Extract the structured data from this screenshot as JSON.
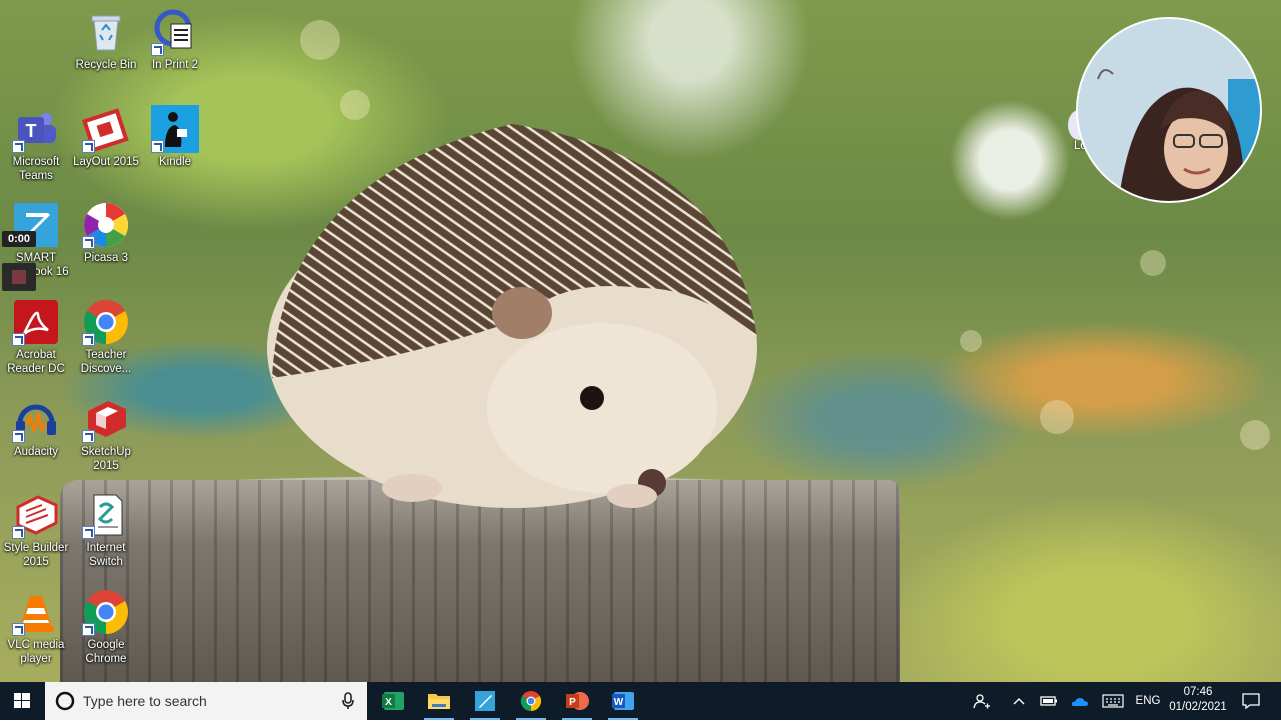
{
  "desktop": {
    "icons": [
      {
        "label": "Recycle Bin",
        "icon": "recycle-bin-icon"
      },
      {
        "label": "In Print 2",
        "icon": "in-print-icon"
      },
      {
        "label": "Microsoft Teams",
        "icon": "teams-icon"
      },
      {
        "label": "LayOut 2015",
        "icon": "layout-icon"
      },
      {
        "label": "Kindle",
        "icon": "kindle-icon"
      },
      {
        "label": "SMART Notebook 16",
        "icon": "smart-notebook-icon"
      },
      {
        "label": "Picasa 3",
        "icon": "picasa-icon"
      },
      {
        "label": "Acrobat Reader DC",
        "icon": "acrobat-icon"
      },
      {
        "label": "Teacher Discove...",
        "icon": "chrome-icon"
      },
      {
        "label": "Audacity",
        "icon": "audacity-icon"
      },
      {
        "label": "SketchUp 2015",
        "icon": "sketchup-icon"
      },
      {
        "label": "Style Builder 2015",
        "icon": "style-builder-icon"
      },
      {
        "label": "Internet Switch",
        "icon": "internet-switch-icon"
      },
      {
        "label": "VLC media player",
        "icon": "vlc-icon"
      },
      {
        "label": "Google Chrome",
        "icon": "chrome-icon"
      }
    ],
    "partial_icon_label": "Loo"
  },
  "recorder": {
    "time": "0:00",
    "stop_color": "#7a3a44"
  },
  "taskbar": {
    "search_placeholder": "Type here to search",
    "pinned": [
      "Excel",
      "File Explorer",
      "SMART Notebook",
      "Google Chrome",
      "PowerPoint",
      "Word"
    ],
    "language": "ENG",
    "time": "07:46",
    "date": "01/02/2021",
    "accent": "#76b9ed"
  }
}
